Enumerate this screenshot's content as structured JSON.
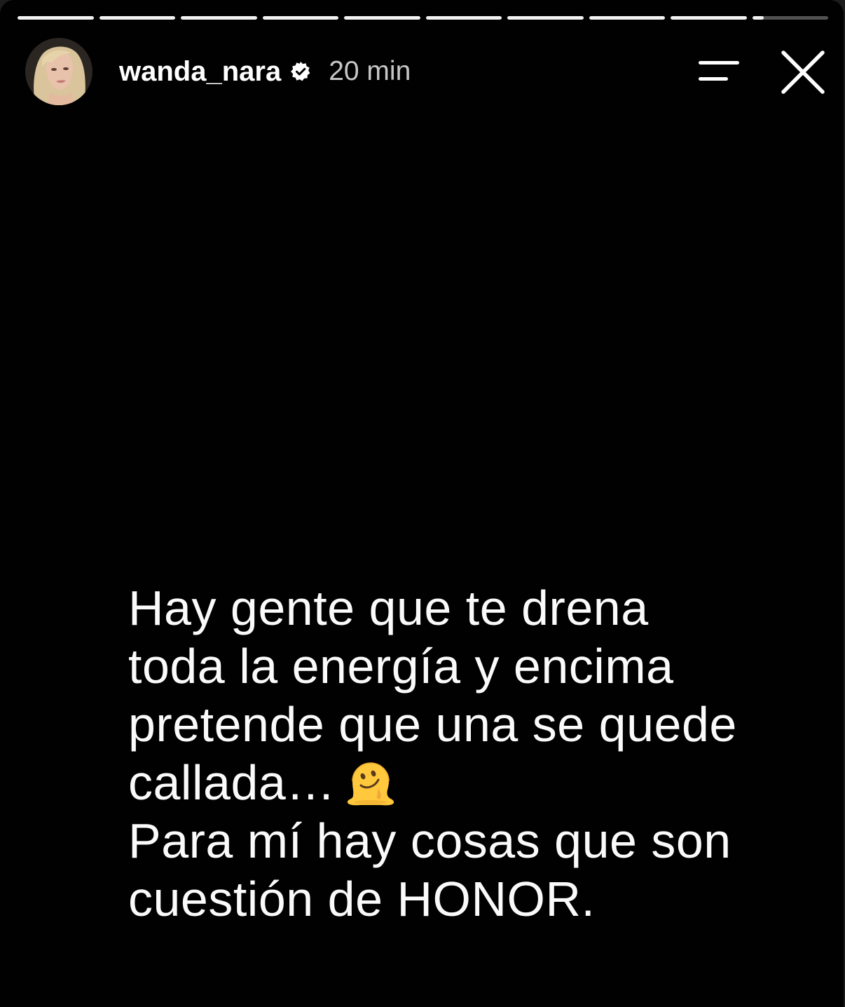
{
  "story": {
    "progress": [
      1,
      1,
      1,
      1,
      1,
      1,
      1,
      1,
      1,
      0.15
    ],
    "user": {
      "username": "wanda_nara",
      "verified": true,
      "time": "20 min"
    },
    "icons": {
      "avatar": "profile-photo",
      "verified": "verified-badge-icon",
      "menu": "menu-lines-icon",
      "close": "close-icon",
      "emoji": "melting-face-icon"
    },
    "text_lines": [
      "Hay gente que te drena",
      "toda la energía y encima",
      "pretende que una se quede",
      "callada…",
      "Para mí hay cosas que son",
      "cuestión de HONOR."
    ],
    "colors": {
      "background": "#010101",
      "text": "#fafafa",
      "progress_filled": "#f2f2f2",
      "progress_empty": "rgba(255,255,255,0.32)",
      "emoji_yellow": "#FFC83D"
    }
  }
}
